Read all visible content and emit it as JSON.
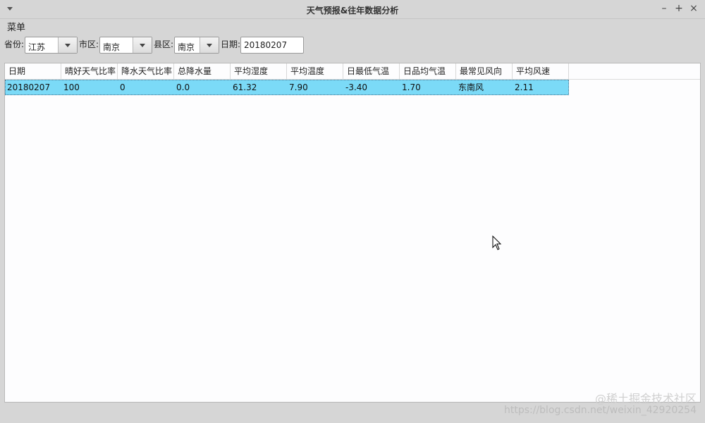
{
  "window": {
    "title": "天气预报&往年数据分析"
  },
  "menubar": {
    "menu_label": "菜单"
  },
  "filters": {
    "province_label": "省份:",
    "province_value": "江苏",
    "city_label": "市区:",
    "city_value": "南京",
    "county_label": "县区:",
    "county_value": "南京",
    "date_label": "日期:",
    "date_value": "20180207"
  },
  "table": {
    "columns": [
      "日期",
      "晴好天气比率",
      "降水天气比率",
      "总降水量",
      "平均湿度",
      "平均温度",
      "日最低气温",
      "日品均气温",
      "最常见风向",
      "平均风速"
    ],
    "rows": [
      [
        "20180207",
        "100",
        "0",
        "0.0",
        "61.32",
        "7.90",
        "-3.40",
        "1.70",
        "东南风",
        "2.11"
      ]
    ],
    "selected_row_color": "#7bdaf7"
  },
  "watermark": {
    "text": "https://blog.csdn.net/weixin_42920254",
    "brand": "@稀土掘金技术社区"
  }
}
